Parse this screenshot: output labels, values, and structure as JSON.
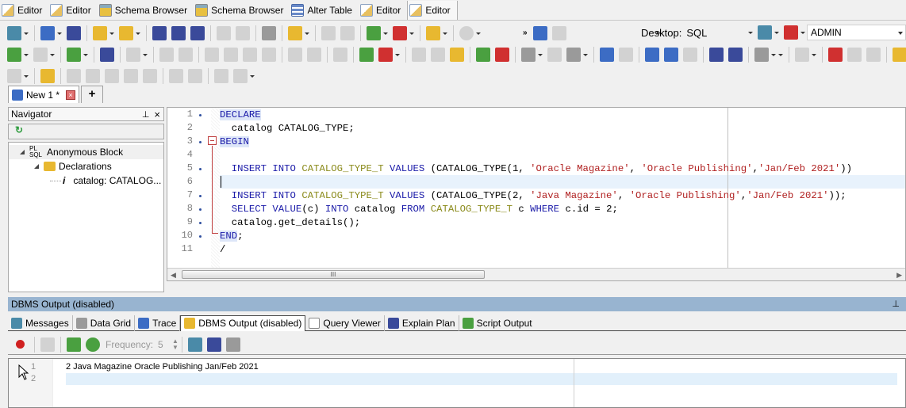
{
  "window_tabs": [
    {
      "label": "Editor",
      "icon": "editor-icon"
    },
    {
      "label": "Editor",
      "icon": "editor-icon"
    },
    {
      "label": "Schema Browser",
      "icon": "schema-browser-icon"
    },
    {
      "label": "Schema Browser",
      "icon": "schema-browser-icon"
    },
    {
      "label": "Alter Table",
      "icon": "alter-table-icon"
    },
    {
      "label": "Editor",
      "icon": "editor-icon"
    },
    {
      "label": "Editor",
      "icon": "editor-icon",
      "active": true
    }
  ],
  "toolbar": {
    "desktop_label": "Desktop:",
    "desktop_value": "SQL",
    "connection": "ADMIN"
  },
  "document_tab": {
    "label": "New 1 *",
    "add_label": "+"
  },
  "navigator": {
    "title": "Navigator",
    "pin": "⊑",
    "close": "×",
    "refresh": "↻",
    "tree": [
      {
        "label": "Anonymous Block",
        "icon": "plsql-icon",
        "level": 0
      },
      {
        "label": "Declarations",
        "icon": "folder-icon",
        "level": 1
      },
      {
        "label": "catalog: CATALOG...",
        "icon": "variable-icon",
        "level": 2
      }
    ]
  },
  "editor": {
    "line_numbers": [
      "1",
      "2",
      "3",
      "4",
      "5",
      "6",
      "7",
      "8",
      "9",
      "10",
      "11"
    ],
    "lines": [
      [
        {
          "t": "DECLARE",
          "c": "kwb"
        }
      ],
      [
        {
          "t": "  catalog CATALOG_TYPE;",
          "c": ""
        }
      ],
      [
        {
          "t": "BEGIN",
          "c": "kwb"
        }
      ],
      [],
      [
        {
          "t": "  INSERT INTO ",
          "c": "kw"
        },
        {
          "t": "CATALOG_TYPE_T",
          "c": "tbl"
        },
        {
          "t": " VALUES ",
          "c": "kw"
        },
        {
          "t": "(CATALOG_TYPE(1, ",
          "c": ""
        },
        {
          "t": "'Oracle Magazine'",
          "c": "str"
        },
        {
          "t": ", ",
          "c": ""
        },
        {
          "t": "'Oracle Publishing'",
          "c": "str"
        },
        {
          "t": ",",
          "c": ""
        },
        {
          "t": "'Jan/Feb 2021'",
          "c": "str"
        },
        {
          "t": "))",
          "c": ""
        }
      ],
      [],
      [
        {
          "t": "  INSERT INTO ",
          "c": "kw"
        },
        {
          "t": "CATALOG_TYPE_T",
          "c": "tbl"
        },
        {
          "t": " VALUES ",
          "c": "kw"
        },
        {
          "t": "(CATALOG_TYPE(2, ",
          "c": ""
        },
        {
          "t": "'Java Magazine'",
          "c": "str"
        },
        {
          "t": ", ",
          "c": ""
        },
        {
          "t": "'Oracle Publishing'",
          "c": "str"
        },
        {
          "t": ",",
          "c": ""
        },
        {
          "t": "'Jan/Feb 2021'",
          "c": "str"
        },
        {
          "t": "));",
          "c": ""
        }
      ],
      [
        {
          "t": "  SELECT VALUE",
          "c": "kw"
        },
        {
          "t": "(c) ",
          "c": ""
        },
        {
          "t": "INTO",
          "c": "kw"
        },
        {
          "t": " catalog ",
          "c": ""
        },
        {
          "t": "FROM ",
          "c": "kw"
        },
        {
          "t": "CATALOG_TYPE_T",
          "c": "tbl"
        },
        {
          "t": " c ",
          "c": ""
        },
        {
          "t": "WHERE",
          "c": "kw"
        },
        {
          "t": " c.id = 2;",
          "c": ""
        }
      ],
      [
        {
          "t": "  catalog.get_details();",
          "c": ""
        }
      ],
      [
        {
          "t": "END",
          "c": "kwb"
        },
        {
          "t": ";",
          "c": ""
        }
      ],
      [
        {
          "t": "/",
          "c": ""
        }
      ]
    ],
    "scroll_grip": "III"
  },
  "output_panel": {
    "title": "DBMS Output (disabled)",
    "tabs": [
      {
        "label": "Messages"
      },
      {
        "label": "Data Grid"
      },
      {
        "label": "Trace"
      },
      {
        "label": "DBMS Output (disabled)",
        "active": true
      },
      {
        "label": "Query Viewer"
      },
      {
        "label": "Explain Plan"
      },
      {
        "label": "Script Output"
      }
    ],
    "frequency_label": "Frequency:",
    "frequency_value": "5",
    "line_numbers": [
      "1",
      "2"
    ],
    "output_lines": [
      "2 Java Magazine Oracle Publishing Jan/Feb 2021",
      ""
    ]
  }
}
